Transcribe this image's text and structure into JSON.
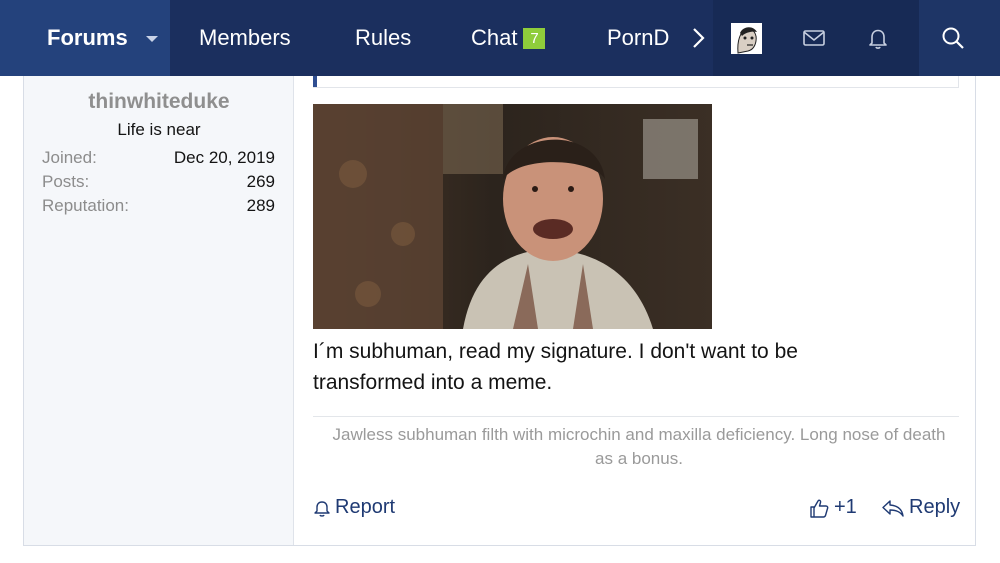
{
  "nav": {
    "forums_label": "Forums",
    "members_label": "Members",
    "rules_label": "Rules",
    "chat_label": "Chat",
    "chat_badge": "7",
    "porn_label": "PornD"
  },
  "post": {
    "user": {
      "name": "thinwhiteduke",
      "title": "Life is near",
      "stats": [
        {
          "key": "Joined:",
          "value": "Dec 20, 2019"
        },
        {
          "key": "Posts:",
          "value": "269"
        },
        {
          "key": "Reputation:",
          "value": "289"
        }
      ]
    },
    "text": "I´m subhuman, read my signature. I don't want to be transformed into a meme.",
    "signature": "Jawless subhuman filth with microchin and maxilla deficiency. Long nose of death as a bonus.",
    "actions": {
      "report_label": "Report",
      "like_count": "+1",
      "reply_label": "Reply"
    }
  },
  "colors": {
    "nav_bg": "#1b2f5e",
    "nav_active": "#24427c",
    "badge": "#8fcd3b",
    "link": "#1f3a73"
  }
}
